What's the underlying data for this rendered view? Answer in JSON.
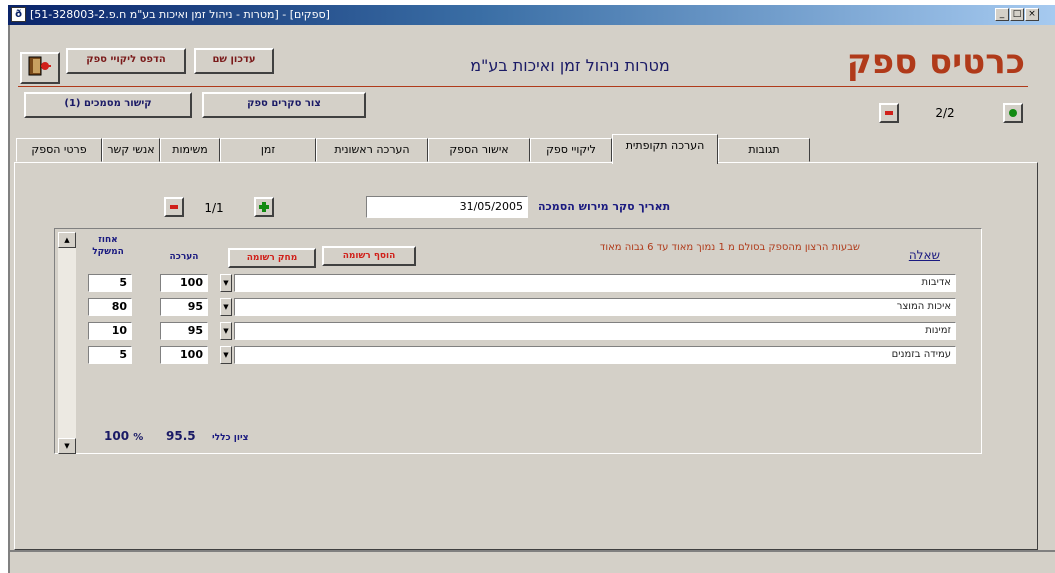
{
  "window": {
    "title": "[מטרות - ניהול זמן ואיכות בע\"מ ח.פ.51-328003-2]  - [ספקים]",
    "min_label": "_",
    "max_label": "□",
    "close_label": "×"
  },
  "header": {
    "page_title": "כרטיס ספק",
    "company_name": "מטרות ניהול זמן ואיכות בע\"מ",
    "record_counter": "2/2"
  },
  "toolbar": {
    "exit_label": "",
    "print_customers_label": "הדפס ליקויי ספק",
    "update_label": "עדכון שם",
    "contacts_label": "קישור מסמכים (1)",
    "new_evaluation_label": "צור סקרים ספק"
  },
  "tabs": [
    {
      "label": "פרטי הספק"
    },
    {
      "label": "אנשי קשר"
    },
    {
      "label": "משימות"
    },
    {
      "label": "זמן"
    },
    {
      "label": "הערכה ראשונית"
    },
    {
      "label": "אישור הספק"
    },
    {
      "label": "ליקויי ספק"
    },
    {
      "label": "הערכה תקופתית"
    },
    {
      "label": "תגובות"
    }
  ],
  "evaluation": {
    "survey_date_label": "תאריך סקר מירוש הסמכה",
    "survey_date": "31/05/2005",
    "sub_counter": "1/1",
    "question_header": "שאלה",
    "scale_note": "שבעות הרצון מהספק בסולם מ 1 נמוך מאוד עד 6 גבוה מאוד",
    "add_row_label": "הוסף רשומה",
    "delete_row_label": "מחק רשומה",
    "score_header": "הערכה",
    "weight_header": "אחוז המשקל",
    "rows": [
      {
        "question": "אדיבות",
        "score": "100",
        "weight": "5"
      },
      {
        "question": "איכות המוצר",
        "score": "95",
        "weight": "80"
      },
      {
        "question": "זמינות",
        "score": "95",
        "weight": "10"
      },
      {
        "question": "עמידה בזמנים",
        "score": "100",
        "weight": "5"
      }
    ],
    "total_label": "ציון כללי",
    "total_score": "95.5",
    "total_weight": "100",
    "percent_sign": "%"
  },
  "colors": {
    "title_red": "#b03a1a",
    "label_blue": "#1a1a80",
    "chrome": "#d4d0c8"
  }
}
